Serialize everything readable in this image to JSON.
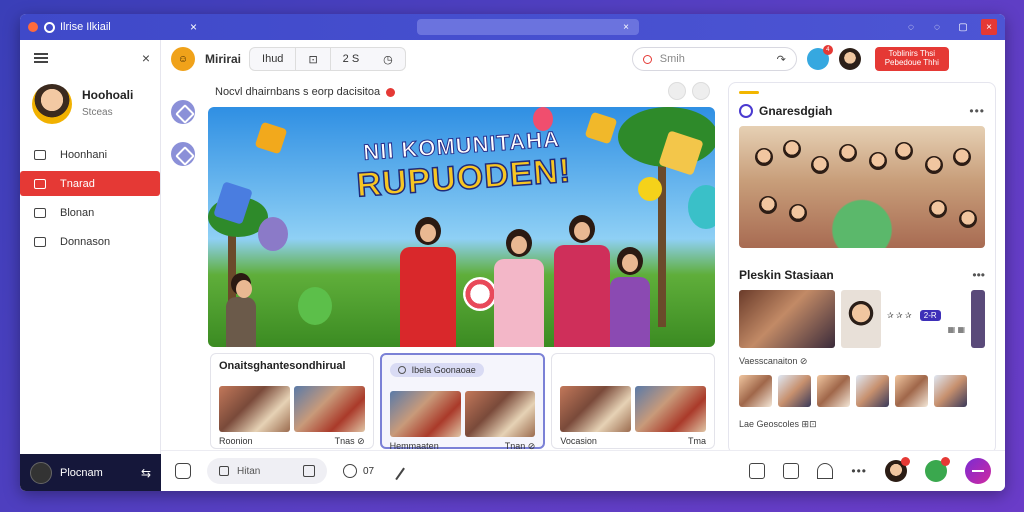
{
  "titlebar": {
    "app_title": "Ilrise Ilkiail",
    "close": "×",
    "omni_close": "×",
    "ctrl_1": "◌",
    "ctrl_2": "◌",
    "ctrl_3": "▢",
    "ctrl_close": "×"
  },
  "sidebar": {
    "close": "×",
    "profile": {
      "name": "Hoohoali",
      "status": "Stceas"
    },
    "items": [
      {
        "label": "Hoonhani",
        "active": false
      },
      {
        "label": "Tnarad",
        "active": true
      },
      {
        "label": "Blonan",
        "active": false
      },
      {
        "label": "Donnason",
        "active": false
      }
    ],
    "footer": {
      "label": "Plocnam",
      "action": "⇆"
    }
  },
  "toolbar": {
    "logo": "☺",
    "title": "Mirirai",
    "group": [
      "Ihud",
      "⊡",
      "2 S",
      "◷"
    ],
    "search": {
      "placeholder": "Smih",
      "forward": "↷"
    },
    "badge": "4",
    "cta": "Toblinirs Thsi\nPebedoue Thhi"
  },
  "feed": {
    "heading": "Nocvl dhairnbans s eorp dacisitoa",
    "hero": {
      "title_line1": "NII KOMUNITAHA",
      "title_line2": "RUPUODEN!"
    },
    "cards": [
      {
        "title": "Onaitsghantesondhirual",
        "chip": "",
        "captions": [
          "Roonion",
          "Tnas ⊘"
        ],
        "selected": false
      },
      {
        "title": "",
        "chip": "Ibela Goonaoae",
        "captions": [
          "Hemmaaten",
          "Tnan ⊘"
        ],
        "selected": true
      },
      {
        "title": "",
        "chip": "",
        "captions": [
          "Vocasion",
          "Tma"
        ],
        "selected": false
      }
    ]
  },
  "right_panel": {
    "section1": {
      "title": "Gnaresdgiah",
      "more": "•••"
    },
    "section2": {
      "title": "Pleskin Stasiaan",
      "more": "•••"
    },
    "row_text": "✰ ✰ ✰",
    "row_tag": "2-R",
    "row_sub": "▦ ▦",
    "subline": "Vaesscanaiton ⊘",
    "footer": "Lae Geoscoles ⊞⊡"
  },
  "bottombar": {
    "input_label": "Hitan",
    "reaction_count": "07",
    "more": "•••"
  },
  "colors": {
    "accent": "#e53935",
    "brand": "#3f49c9",
    "sidebar_footer": "#15173a"
  }
}
